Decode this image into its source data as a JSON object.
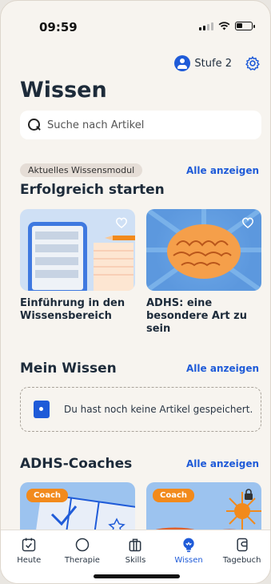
{
  "status": {
    "time": "09:59"
  },
  "header": {
    "level_label": "Stufe 2",
    "title": "Wissen"
  },
  "search": {
    "placeholder": "Suche nach Artikel"
  },
  "current_module": {
    "chip": "Aktuelles Wissensmodul",
    "see_all": "Alle anzeigen",
    "title": "Erfolgreich starten",
    "cards": [
      {
        "title": "Einführung in den Wissensbereich",
        "icon": "heart-outline-icon"
      },
      {
        "title": "ADHS: eine besondere Art zu sein",
        "icon": "heart-outline-icon"
      }
    ]
  },
  "my_knowledge": {
    "title": "Mein Wissen",
    "see_all": "Alle anzeigen",
    "empty_text": "Du hast noch keine Artikel gespeichert."
  },
  "coaches": {
    "title": "ADHS-Coaches",
    "see_all": "Alle anzeigen",
    "badge": "Coach"
  },
  "tabbar": {
    "tabs": [
      {
        "label": "Heute",
        "icon": "calendar-check-icon"
      },
      {
        "label": "Therapie",
        "icon": "circle-icon"
      },
      {
        "label": "Skills",
        "icon": "briefcase-icon"
      },
      {
        "label": "Wissen",
        "icon": "lightbulb-icon",
        "active": true
      },
      {
        "label": "Tagebuch",
        "icon": "journal-icon"
      }
    ]
  },
  "colors": {
    "accent": "#1f5bd8",
    "coach_badge": "#f28a1c",
    "background": "#f7f4ef"
  }
}
